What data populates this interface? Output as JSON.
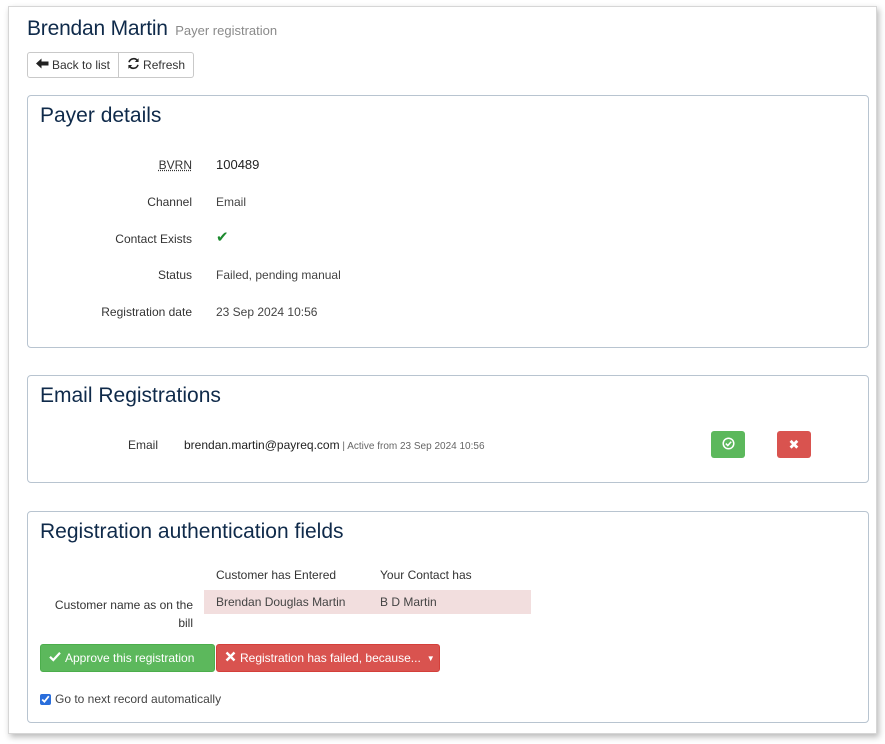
{
  "header": {
    "title": "Brendan Martin",
    "subtitle": "Payer registration"
  },
  "toolbar": {
    "back_label": "Back to list",
    "refresh_label": "Refresh"
  },
  "payer_details": {
    "title": "Payer details",
    "rows": [
      {
        "label": "BVRN",
        "value": "100489"
      },
      {
        "label": "Channel",
        "value": "Email"
      },
      {
        "label": "Contact Exists",
        "value": "✔"
      },
      {
        "label": "Status",
        "value": "Failed, pending manual"
      },
      {
        "label": "Registration date",
        "value": "23 Sep 2024 10:56"
      }
    ]
  },
  "email_registrations": {
    "title": "Email Registrations",
    "label": "Email",
    "address": "brendan.martin@payreq.com",
    "active": " | Active from 23 Sep 2024 10:56",
    "approve_icon": "✔",
    "reject_icon": "✖"
  },
  "auth_fields": {
    "title": "Registration authentication fields",
    "col_entered": "Customer has Entered",
    "col_contact": "Your Contact has",
    "row_label": "Customer name as on the bill",
    "entered_value": "Brendan Douglas Martin",
    "contact_value": "B D Martin"
  },
  "actions": {
    "approve_label": "Approve this registration",
    "fail_label": "Registration has failed, because...",
    "auto_next_label": "Go to next record automatically",
    "auto_next_checked": true
  },
  "colors": {
    "success": "#5cb85c",
    "danger": "#d9534f",
    "title": "#0f2a4a",
    "mismatch": "#f2dede"
  }
}
